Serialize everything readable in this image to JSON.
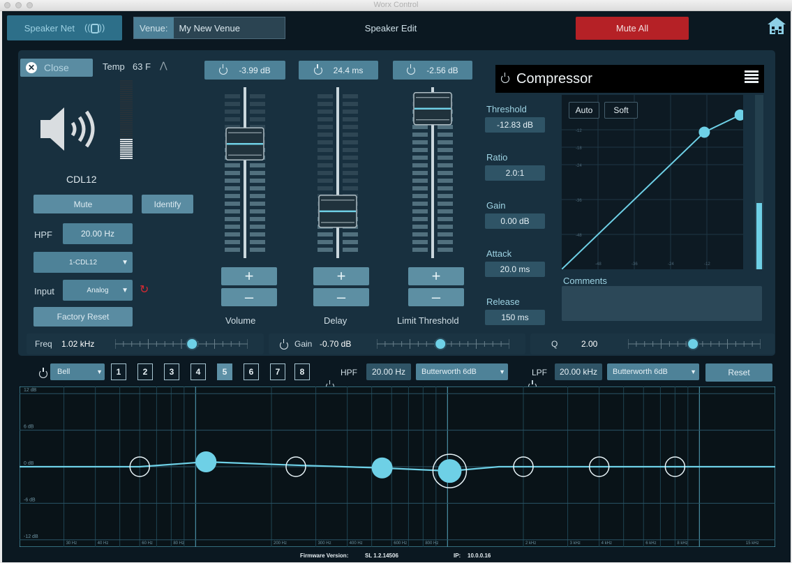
{
  "window": {
    "title": "Worx Control"
  },
  "topbar": {
    "speaker_net": "Speaker Net",
    "venue_label": "Venue:",
    "venue_name": "My New Venue",
    "page_title": "Speaker Edit",
    "mute_all": "Mute All"
  },
  "speaker": {
    "close": "Close",
    "temp_label": "Temp",
    "temp_value": "63 F",
    "name": "CDL12",
    "mute": "Mute",
    "identify": "Identify",
    "hpf_label": "HPF",
    "hpf_value": "20.00 Hz",
    "preset": "1-CDL12",
    "input_label": "Input",
    "input_value": "Analog",
    "factory_reset": "Factory Reset"
  },
  "faders": {
    "volume": {
      "value": "-3.99 dB",
      "label": "Volume",
      "level": 0.69
    },
    "delay": {
      "value": "24.4 ms",
      "label": "Delay",
      "level": 0.27
    },
    "limit": {
      "value": "-2.56 dB",
      "label": "Limit Threshold",
      "level": 0.91
    },
    "plus": "+",
    "minus": "–"
  },
  "compressor": {
    "title": "Compressor",
    "threshold_label": "Threshold",
    "threshold": "-12.83 dB",
    "ratio_label": "Ratio",
    "ratio": "2.0:1",
    "gain_label": "Gain",
    "gain": "0.00 dB",
    "attack_label": "Attack",
    "attack": "20.0 ms",
    "release_label": "Release",
    "release": "150 ms",
    "auto": "Auto",
    "soft": "Soft",
    "comments_label": "Comments",
    "y_ticks": [
      "-12",
      "-18",
      "-24",
      "-36",
      "-48"
    ],
    "x_ticks": [
      "-48",
      "-36",
      "-24",
      "-12"
    ],
    "meter_level": 0.38
  },
  "eq_sliders": {
    "freq_label": "Freq",
    "freq_value": "1.02 kHz",
    "gain_label": "Gain",
    "gain_value": "-0.70 dB",
    "q_label": "Q",
    "q_value": "2.00"
  },
  "eq_bar": {
    "filter_type": "Bell",
    "bands": [
      "1",
      "2",
      "3",
      "4",
      "5",
      "6",
      "7",
      "8"
    ],
    "selected_band": "5",
    "hpf_label": "HPF",
    "hpf_value": "20.00 Hz",
    "hpf_type": "Butterworth 6dB",
    "lpf_label": "LPF",
    "lpf_value": "20.00 kHz",
    "lpf_type": "Butterworth 6dB",
    "reset": "Reset"
  },
  "eq_graph": {
    "y_labels": [
      "12 dB",
      "6 dB",
      "0 dB",
      "-6 dB",
      "-12 dB"
    ],
    "x_labels": [
      "30 Hz",
      "40 Hz",
      "60 Hz",
      "80 Hz",
      "200 Hz",
      "300 Hz",
      "400 Hz",
      "600 Hz",
      "800 Hz",
      "2 kHz",
      "3 kHz",
      "4 kHz",
      "6 kHz",
      "8 kHz",
      "15 kHz"
    ]
  },
  "footer": {
    "firmware_label": "Firmware Version:",
    "firmware": "SL 1.2.14506",
    "ip_label": "IP:",
    "ip": "10.0.0.16"
  }
}
